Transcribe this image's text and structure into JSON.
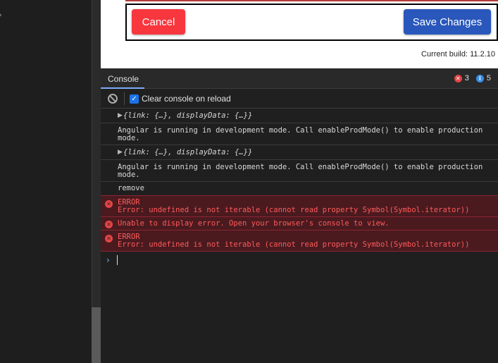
{
  "app": {
    "form": {
      "cancel_label": "Cancel",
      "save_label": "Save Changes",
      "build_label": "Current build: 11.2.10"
    }
  },
  "devtools": {
    "tab_label": "Console",
    "error_count": "3",
    "info_count": "5",
    "clear_console_label": "Clear console on reload",
    "messages": [
      {
        "type": "object",
        "text": "{link: {…}, displayData: {…}}"
      },
      {
        "type": "log",
        "text": "Angular is running in development mode. Call enableProdMode() to enable production",
        "text2": "mode."
      },
      {
        "type": "object",
        "text": "{link: {…}, displayData: {…}}"
      },
      {
        "type": "log",
        "text": "Angular is running in development mode. Call enableProdMode() to enable production",
        "text2": "mode."
      },
      {
        "type": "log",
        "text": "remove"
      },
      {
        "type": "error",
        "text": "ERROR",
        "text2": "Error: undefined is not iterable (cannot read property Symbol(Symbol.iterator))"
      },
      {
        "type": "error",
        "text": "Unable to display error. Open your browser's console to view."
      },
      {
        "type": "error",
        "text": "ERROR",
        "text2": "Error: undefined is not iterable (cannot read property Symbol(Symbol.iterator))"
      }
    ]
  },
  "colors": {
    "cancel_bg": "#f7363e",
    "save_bg": "#2957bb",
    "error_text": "#ff5a5a",
    "error_bg": "#4a1a1f",
    "console_bg": "#1f1f1f"
  },
  "icons": {
    "error": "error-circle-icon",
    "info": "info-circle-icon",
    "clear": "clear-console-icon",
    "expand": "expand-triangle-icon",
    "prompt": "prompt-chevron-icon"
  }
}
